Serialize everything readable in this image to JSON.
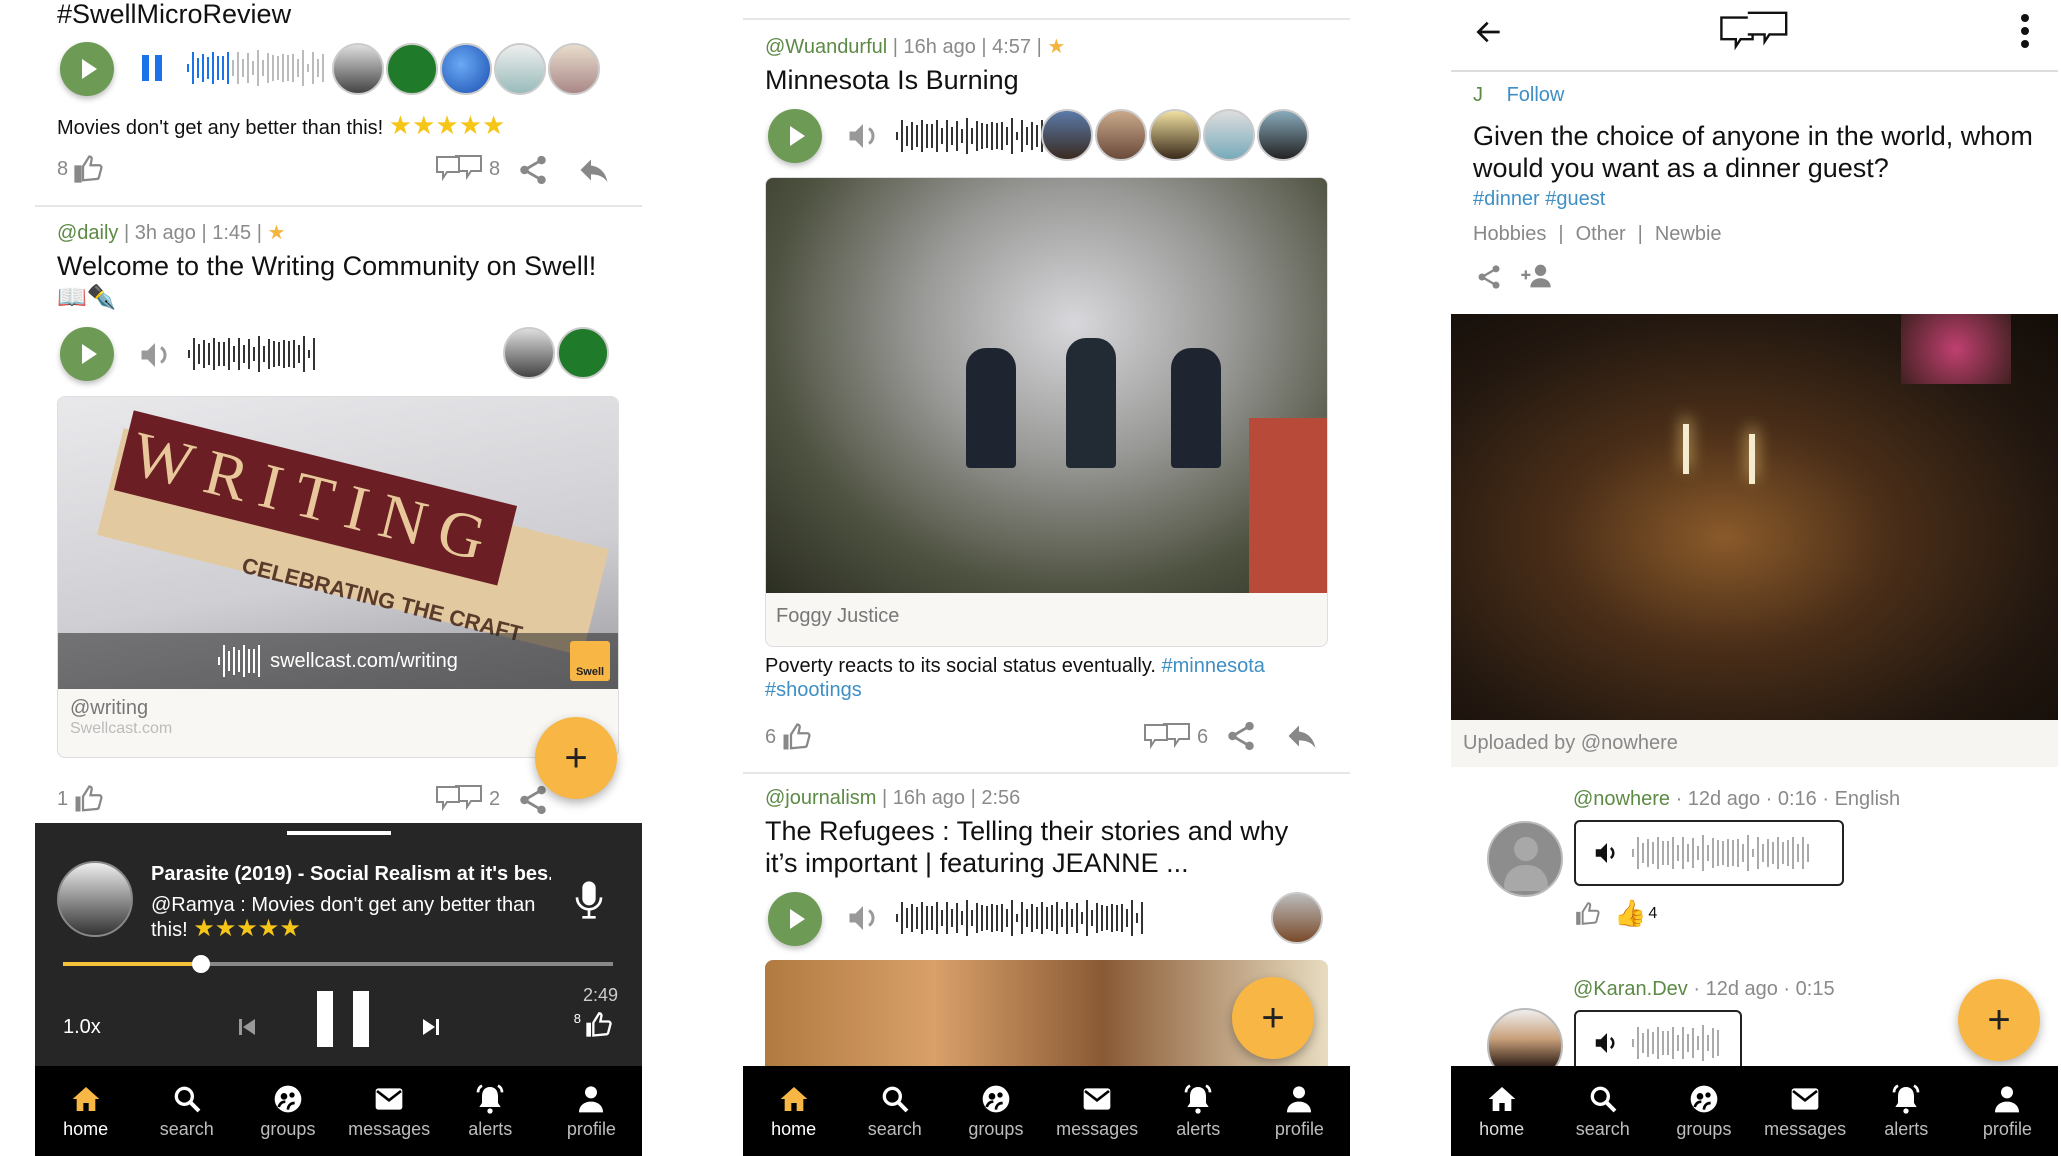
{
  "colors": {
    "accent": "#f8b645",
    "play": "#6d9a55",
    "user": "#5c8a45",
    "hashtag": "#3f8fc4",
    "pause_blue": "#1a73e8"
  },
  "nav": [
    {
      "label": "home",
      "icon": "home-icon"
    },
    {
      "label": "search",
      "icon": "search-icon"
    },
    {
      "label": "groups",
      "icon": "groups-icon"
    },
    {
      "label": "messages",
      "icon": "mail-icon"
    },
    {
      "label": "alerts",
      "icon": "bell-icon"
    },
    {
      "label": "profile",
      "icon": "person-icon"
    }
  ],
  "panel1": {
    "post1": {
      "title": "#SwellMicroReview",
      "text": "Movies don't get any better than this!",
      "stars": "★★★★★",
      "likes": "8",
      "comments": "8"
    },
    "post2": {
      "user": "@daily",
      "meta": " | 3h ago | 1:45 | ",
      "star": "★",
      "title": "Welcome to the Writing Community on Swell!",
      "emoji": "📖✒️",
      "card_overlay": "swellcast.com/writing",
      "card_badge": "Swell",
      "card_user": "@writing",
      "card_site": "Swellcast.com",
      "image_word": "WRITING",
      "image_sub": "CELEBRATING THE CRAFT",
      "likes": "1",
      "comments": "2"
    },
    "player": {
      "title": "Parasite (2019) - Social Realism at it's bes...",
      "user": "@Ramya :",
      "text": "Movies don't get any better than this!",
      "stars": "★★★★★",
      "progress": 0.25,
      "duration": "2:49",
      "speed": "1.0x",
      "likes": "8"
    },
    "fab": "+",
    "active_nav": 0
  },
  "panel2": {
    "post1": {
      "user": "@Wuandurful",
      "meta": " | 16h ago | 4:57 | ",
      "star": "★",
      "title": "Minnesota Is Burning",
      "card_caption": "Foggy Justice",
      "text": "Poverty reacts to its social status eventually.",
      "tags": [
        "#minnesota",
        "#shootings"
      ],
      "likes": "6",
      "comments": "6"
    },
    "post2": {
      "user": "@journalism",
      "meta": " | 16h ago | 2:56",
      "title": "The Refugees :  Telling their stories and why it’s important | featuring JEANNE ..."
    },
    "fab": "+",
    "active_nav": 0
  },
  "panel3": {
    "author": "J",
    "follow": "Follow",
    "question": "Given the choice of anyone in the world, whom would you want as a dinner guest?",
    "tags": "#dinner #guest",
    "categories": [
      "Hobbies",
      "Other",
      "Newbie"
    ],
    "upload_caption": "Uploaded by @nowhere",
    "replies": [
      {
        "user": "@nowhere",
        "meta": " · 12d ago · 0:16 · English",
        "reaction_count": "4",
        "reaction": "👍"
      },
      {
        "user": "@Karan.Dev",
        "meta": " · 12d ago · 0:15"
      }
    ],
    "fab": "+",
    "active_nav": -1
  }
}
